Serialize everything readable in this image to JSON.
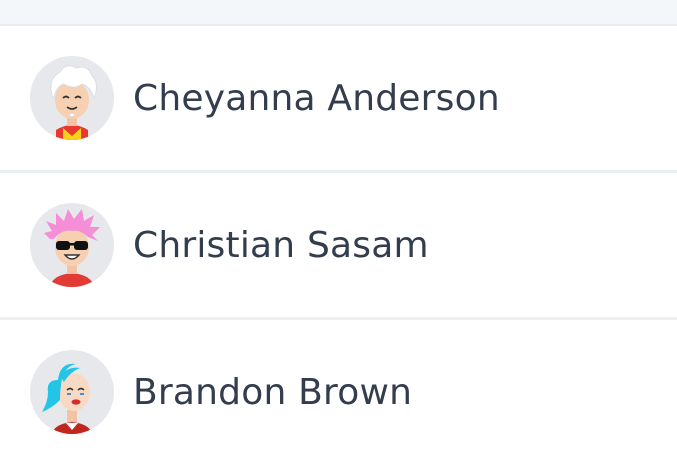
{
  "contacts": [
    {
      "name": "Cheyanna Anderson",
      "avatar_icon": "white-haired-person-avatar-icon"
    },
    {
      "name": "Christian Sasam",
      "avatar_icon": "pink-haired-sunglasses-avatar-icon"
    },
    {
      "name": "Brandon Brown",
      "avatar_icon": "teal-ponytail-avatar-icon"
    }
  ],
  "colors": {
    "name_text": "#333d4e",
    "avatar_bg": "#e6e8ec",
    "row_bg": "#ffffff",
    "divider": "#eceff2"
  }
}
